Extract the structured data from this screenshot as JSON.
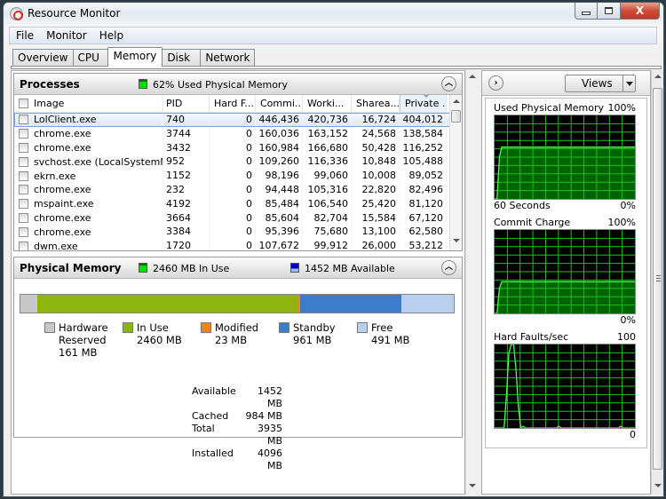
{
  "window": {
    "title": "Resource Monitor",
    "controls": {
      "minimize": "minimize",
      "maximize": "maximize",
      "close": "X"
    }
  },
  "menu": [
    "File",
    "Monitor",
    "Help"
  ],
  "tabs": [
    {
      "label": "Overview",
      "active": false
    },
    {
      "label": "CPU",
      "active": false
    },
    {
      "label": "Memory",
      "active": true
    },
    {
      "label": "Disk",
      "active": false
    },
    {
      "label": "Network",
      "active": false
    }
  ],
  "processes": {
    "title": "Processes",
    "summary": "62% Used Physical Memory",
    "summary_color": "#00e000",
    "columns": [
      "Image",
      "PID",
      "Hard F...",
      "Commi...",
      "Worki...",
      "Sharea...",
      "Private ..."
    ],
    "sorted_column": "Private ...",
    "rows": [
      {
        "image": "LolClient.exe",
        "pid": "740",
        "hard_faults": "0",
        "commit": "446,436",
        "working": "420,736",
        "shareable": "16,724",
        "private": "404,012",
        "selected": true
      },
      {
        "image": "chrome.exe",
        "pid": "3744",
        "hard_faults": "0",
        "commit": "160,036",
        "working": "163,152",
        "shareable": "24,568",
        "private": "138,584"
      },
      {
        "image": "chrome.exe",
        "pid": "3432",
        "hard_faults": "0",
        "commit": "160,984",
        "working": "166,680",
        "shareable": "50,428",
        "private": "116,252"
      },
      {
        "image": "svchost.exe (LocalSystemNet...",
        "pid": "952",
        "hard_faults": "0",
        "commit": "109,260",
        "working": "116,336",
        "shareable": "10,848",
        "private": "105,488"
      },
      {
        "image": "ekrn.exe",
        "pid": "1152",
        "hard_faults": "0",
        "commit": "98,196",
        "working": "99,060",
        "shareable": "10,008",
        "private": "89,052"
      },
      {
        "image": "chrome.exe",
        "pid": "232",
        "hard_faults": "0",
        "commit": "94,448",
        "working": "105,316",
        "shareable": "22,820",
        "private": "82,496"
      },
      {
        "image": "mspaint.exe",
        "pid": "4192",
        "hard_faults": "0",
        "commit": "85,484",
        "working": "106,540",
        "shareable": "25,420",
        "private": "81,120"
      },
      {
        "image": "chrome.exe",
        "pid": "3664",
        "hard_faults": "0",
        "commit": "85,604",
        "working": "82,704",
        "shareable": "15,584",
        "private": "67,120"
      },
      {
        "image": "chrome.exe",
        "pid": "3384",
        "hard_faults": "0",
        "commit": "95,396",
        "working": "75,680",
        "shareable": "13,100",
        "private": "62,580"
      },
      {
        "image": "dwm.exe",
        "pid": "1720",
        "hard_faults": "0",
        "commit": "107,672",
        "working": "99,912",
        "shareable": "26,000",
        "private": "53,212"
      }
    ]
  },
  "physical_memory": {
    "title": "Physical Memory",
    "in_use_label": "2460 MB In Use",
    "in_use_color": "#00e000",
    "available_label": "1452 MB Available",
    "available_color": "#0000cc",
    "segments": [
      {
        "name": "Hardware Reserved",
        "line1": "Hardware",
        "line2": "Reserved",
        "value": "161 MB",
        "mb": 161,
        "color": "#c8c8c8"
      },
      {
        "name": "In Use",
        "line1": "In Use",
        "line2": "2460 MB",
        "value": "",
        "mb": 2460,
        "color": "#8db40f"
      },
      {
        "name": "Modified",
        "line1": "Modified",
        "line2": "23 MB",
        "value": "",
        "mb": 23,
        "color": "#e8881a"
      },
      {
        "name": "Standby",
        "line1": "Standby",
        "line2": "961 MB",
        "value": "",
        "mb": 961,
        "color": "#3c7cc8"
      },
      {
        "name": "Free",
        "line1": "Free",
        "line2": "491 MB",
        "value": "",
        "mb": 491,
        "color": "#b8d0ee"
      }
    ],
    "stats": [
      {
        "label": "Available",
        "value": "1452 MB"
      },
      {
        "label": "Cached",
        "value": "984 MB"
      },
      {
        "label": "Total",
        "value": "3935 MB"
      },
      {
        "label": "Installed",
        "value": "4096 MB"
      }
    ]
  },
  "graphs_panel": {
    "views_label": "Views",
    "graphs": [
      {
        "title": "Used Physical Memory",
        "max_label": "100%",
        "min_label": "0%",
        "footer_left": "60 Seconds",
        "max": 100,
        "series": [
          0,
          0,
          50,
          62,
          62,
          62,
          62,
          62,
          62,
          62,
          62,
          62,
          62,
          62,
          62,
          62,
          62,
          62,
          62,
          62,
          62,
          62,
          62,
          62,
          62,
          62,
          62,
          62,
          62,
          62,
          62,
          62,
          62,
          62,
          62,
          62,
          62,
          62,
          62,
          62,
          62,
          62,
          62,
          62,
          62,
          62,
          62,
          62,
          62,
          62,
          62,
          62,
          62,
          62,
          62,
          62,
          62,
          62,
          62,
          62
        ]
      },
      {
        "title": "Commit Charge",
        "max_label": "100%",
        "min_label": "0%",
        "footer_left": "",
        "max": 100,
        "series": [
          0,
          0,
          30,
          38,
          38,
          38,
          38,
          38,
          38,
          38,
          38,
          38,
          38,
          38,
          38,
          38,
          38,
          38,
          38,
          38,
          38,
          38,
          38,
          38,
          38,
          38,
          38,
          38,
          38,
          38,
          38,
          38,
          38,
          38,
          38,
          38,
          38,
          38,
          38,
          38,
          38,
          38,
          38,
          38,
          38,
          38,
          38,
          38,
          38,
          38,
          38,
          38,
          38,
          38,
          38,
          38,
          38,
          38,
          38,
          38
        ]
      },
      {
        "title": "Hard Faults/sec",
        "max_label": "100",
        "min_label": "0",
        "footer_left": "",
        "max": 100,
        "series": [
          0,
          0,
          0,
          0,
          0,
          40,
          90,
          100,
          100,
          70,
          25,
          0,
          2,
          0,
          0,
          0,
          0,
          0,
          0,
          0,
          0,
          0,
          0,
          0,
          0,
          0,
          0,
          2,
          0,
          0,
          0,
          0,
          0,
          0,
          0,
          0,
          0,
          0,
          0,
          0,
          0,
          0,
          0,
          0,
          0,
          0,
          0,
          0,
          0,
          0,
          0,
          0,
          0,
          2,
          0,
          0,
          0,
          0,
          0,
          0
        ]
      }
    ]
  }
}
